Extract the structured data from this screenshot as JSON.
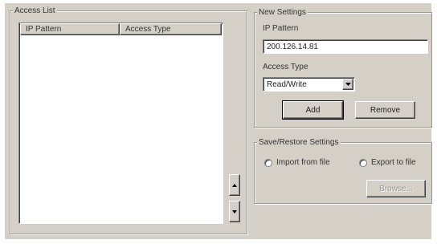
{
  "access_list": {
    "title": "Access List",
    "columns": [
      "IP Pattern",
      "Access Type"
    ],
    "rows": []
  },
  "scroll_buttons": {
    "up_icon": "triangle-up-icon",
    "down_icon": "triangle-down-icon"
  },
  "new_settings": {
    "title": "New Settings",
    "ip_label": "IP Pattern",
    "ip_value": "200.126.14.81",
    "access_label": "Access Type",
    "access_value": "Read/Write",
    "add_label": "Add",
    "remove_label": "Remove"
  },
  "save_restore": {
    "title": "Save/Restore Settings",
    "import_label": "Import from file",
    "export_label": "Export to file",
    "browse_label": "Browse..."
  }
}
